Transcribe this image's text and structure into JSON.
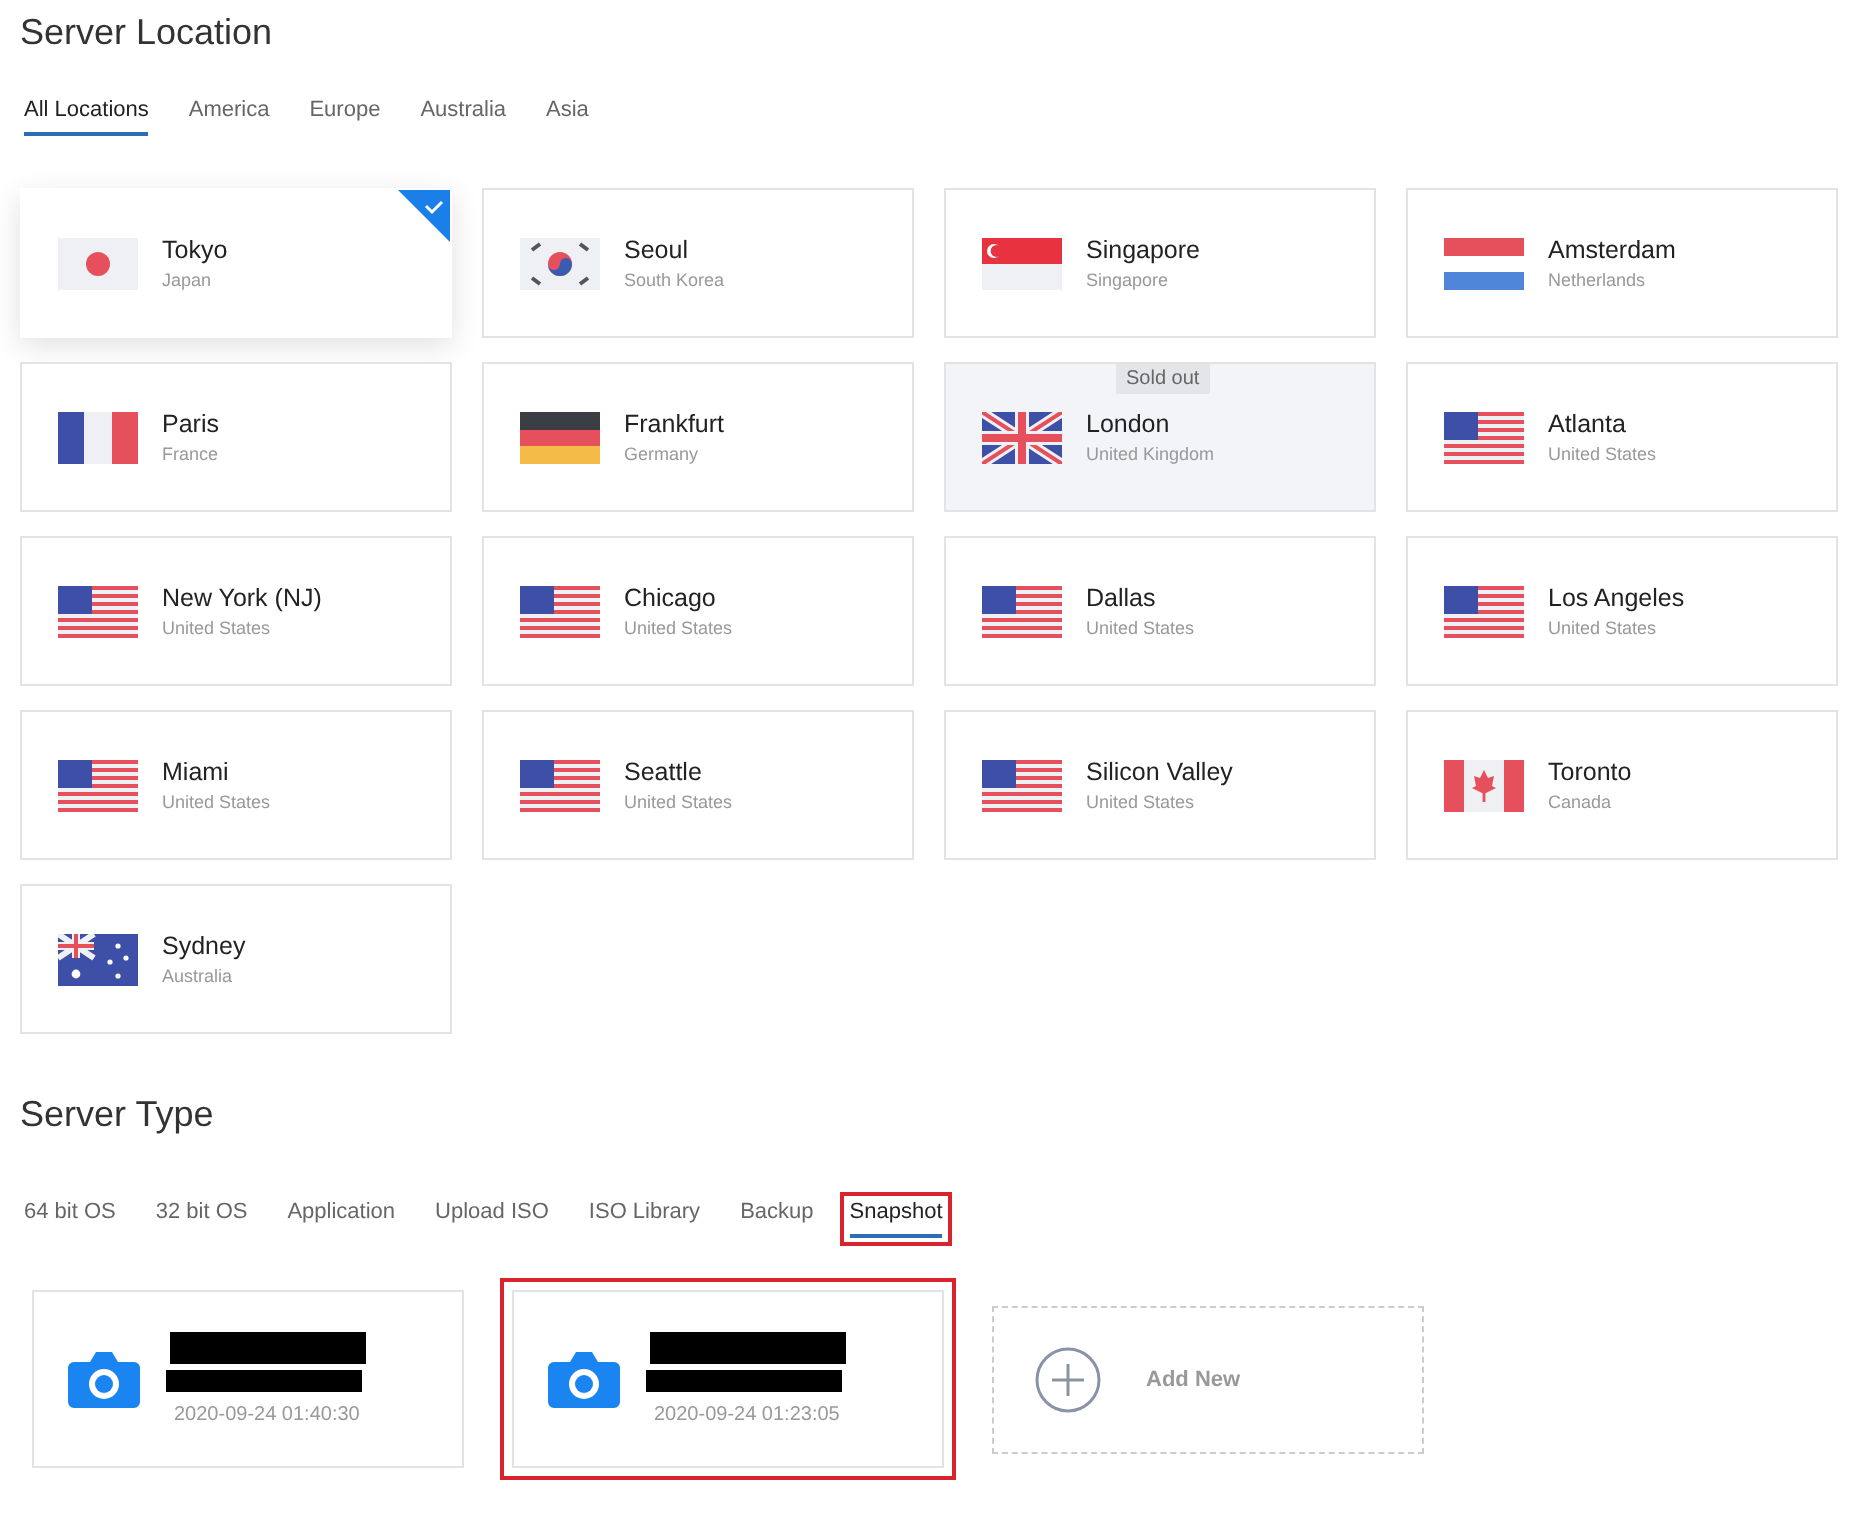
{
  "location_title": "Server Location",
  "location_tabs": [
    {
      "label": "All Locations",
      "selected": true
    },
    {
      "label": "America",
      "selected": false
    },
    {
      "label": "Europe",
      "selected": false
    },
    {
      "label": "Australia",
      "selected": false
    },
    {
      "label": "Asia",
      "selected": false
    }
  ],
  "locations": [
    {
      "city": "Tokyo",
      "country": "Japan",
      "kind": "jp",
      "selected": true,
      "sold_out": false
    },
    {
      "city": "Seoul",
      "country": "South Korea",
      "kind": "kr",
      "selected": false,
      "sold_out": false
    },
    {
      "city": "Singapore",
      "country": "Singapore",
      "kind": "sg",
      "selected": false,
      "sold_out": false
    },
    {
      "city": "Amsterdam",
      "country": "Netherlands",
      "kind": "nl",
      "selected": false,
      "sold_out": false
    },
    {
      "city": "Paris",
      "country": "France",
      "kind": "fr",
      "selected": false,
      "sold_out": false
    },
    {
      "city": "Frankfurt",
      "country": "Germany",
      "kind": "de",
      "selected": false,
      "sold_out": false
    },
    {
      "city": "London",
      "country": "United Kingdom",
      "kind": "gb",
      "selected": false,
      "sold_out": true,
      "badge": "Sold out"
    },
    {
      "city": "Atlanta",
      "country": "United States",
      "kind": "us",
      "selected": false,
      "sold_out": false
    },
    {
      "city": "New York (NJ)",
      "country": "United States",
      "kind": "us",
      "selected": false,
      "sold_out": false
    },
    {
      "city": "Chicago",
      "country": "United States",
      "kind": "us",
      "selected": false,
      "sold_out": false
    },
    {
      "city": "Dallas",
      "country": "United States",
      "kind": "us",
      "selected": false,
      "sold_out": false
    },
    {
      "city": "Los Angeles",
      "country": "United States",
      "kind": "us",
      "selected": false,
      "sold_out": false
    },
    {
      "city": "Miami",
      "country": "United States",
      "kind": "us",
      "selected": false,
      "sold_out": false
    },
    {
      "city": "Seattle",
      "country": "United States",
      "kind": "us",
      "selected": false,
      "sold_out": false
    },
    {
      "city": "Silicon Valley",
      "country": "United States",
      "kind": "us",
      "selected": false,
      "sold_out": false
    },
    {
      "city": "Toronto",
      "country": "Canada",
      "kind": "ca",
      "selected": false,
      "sold_out": false
    },
    {
      "city": "Sydney",
      "country": "Australia",
      "kind": "au",
      "selected": false,
      "sold_out": false
    }
  ],
  "type_title": "Server Type",
  "type_tabs": [
    {
      "label": "64 bit OS",
      "selected": false,
      "highlighted": false
    },
    {
      "label": "32 bit OS",
      "selected": false,
      "highlighted": false
    },
    {
      "label": "Application",
      "selected": false,
      "highlighted": false
    },
    {
      "label": "Upload ISO",
      "selected": false,
      "highlighted": false
    },
    {
      "label": "ISO Library",
      "selected": false,
      "highlighted": false
    },
    {
      "label": "Backup",
      "selected": false,
      "highlighted": false
    },
    {
      "label": "Snapshot",
      "selected": true,
      "highlighted": true
    }
  ],
  "snapshots": [
    {
      "date": "2020-09-24 01:40:30",
      "name_redacted": true,
      "highlighted": false
    },
    {
      "date": "2020-09-24 01:23:05",
      "name_redacted": true,
      "highlighted": true
    }
  ],
  "add_new": {
    "label": "Add New"
  }
}
